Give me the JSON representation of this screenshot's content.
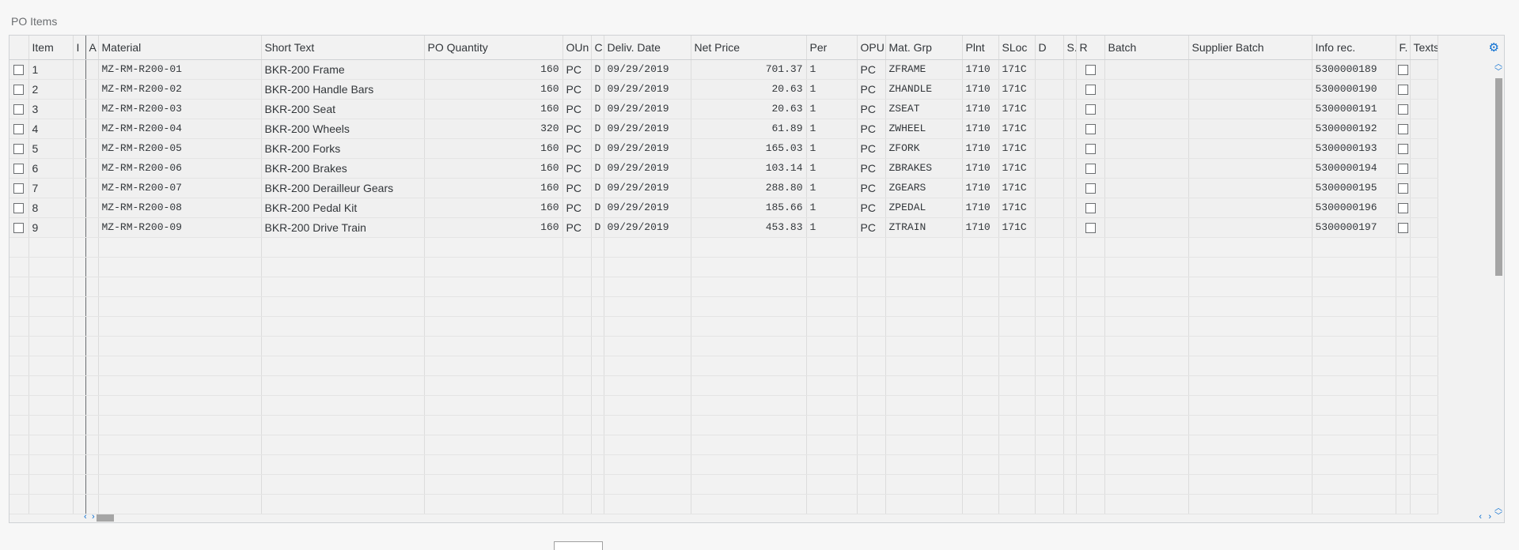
{
  "section_title": "PO Items",
  "columns": [
    "Item",
    "I",
    "A",
    "Material",
    "Short Text",
    "PO Quantity",
    "OUn",
    "C",
    "Deliv. Date",
    "Net Price",
    "Per",
    "OPU",
    "Mat. Grp",
    "Plnt",
    "SLoc",
    "D",
    "S.",
    "R",
    "Batch",
    "Supplier Batch",
    "Info rec.",
    "F.",
    "Texts"
  ],
  "rows": [
    {
      "item": "1",
      "material": "MZ-RM-R200-01",
      "short_text": "BKR-200 Frame",
      "qty": "160",
      "oun": "PC",
      "c": "D",
      "date": "09/29/2019",
      "price": "701.37",
      "per": "1",
      "opu": "PC",
      "matgrp": "ZFRAME",
      "plnt": "1710",
      "sloc": "171C",
      "info": "5300000189"
    },
    {
      "item": "2",
      "material": "MZ-RM-R200-02",
      "short_text": "BKR-200 Handle Bars",
      "qty": "160",
      "oun": "PC",
      "c": "D",
      "date": "09/29/2019",
      "price": "20.63",
      "per": "1",
      "opu": "PC",
      "matgrp": "ZHANDLE",
      "plnt": "1710",
      "sloc": "171C",
      "info": "5300000190"
    },
    {
      "item": "3",
      "material": "MZ-RM-R200-03",
      "short_text": "BKR-200 Seat",
      "qty": "160",
      "oun": "PC",
      "c": "D",
      "date": "09/29/2019",
      "price": "20.63",
      "per": "1",
      "opu": "PC",
      "matgrp": "ZSEAT",
      "plnt": "1710",
      "sloc": "171C",
      "info": "5300000191"
    },
    {
      "item": "4",
      "material": "MZ-RM-R200-04",
      "short_text": "BKR-200 Wheels",
      "qty": "320",
      "oun": "PC",
      "c": "D",
      "date": "09/29/2019",
      "price": "61.89",
      "per": "1",
      "opu": "PC",
      "matgrp": "ZWHEEL",
      "plnt": "1710",
      "sloc": "171C",
      "info": "5300000192"
    },
    {
      "item": "5",
      "material": "MZ-RM-R200-05",
      "short_text": "BKR-200 Forks",
      "qty": "160",
      "oun": "PC",
      "c": "D",
      "date": "09/29/2019",
      "price": "165.03",
      "per": "1",
      "opu": "PC",
      "matgrp": "ZFORK",
      "plnt": "1710",
      "sloc": "171C",
      "info": "5300000193"
    },
    {
      "item": "6",
      "material": "MZ-RM-R200-06",
      "short_text": "BKR-200 Brakes",
      "qty": "160",
      "oun": "PC",
      "c": "D",
      "date": "09/29/2019",
      "price": "103.14",
      "per": "1",
      "opu": "PC",
      "matgrp": "ZBRAKES",
      "plnt": "1710",
      "sloc": "171C",
      "info": "5300000194"
    },
    {
      "item": "7",
      "material": "MZ-RM-R200-07",
      "short_text": "BKR-200 Derailleur Gears",
      "qty": "160",
      "oun": "PC",
      "c": "D",
      "date": "09/29/2019",
      "price": "288.80",
      "per": "1",
      "opu": "PC",
      "matgrp": "ZGEARS",
      "plnt": "1710",
      "sloc": "171C",
      "info": "5300000195"
    },
    {
      "item": "8",
      "material": "MZ-RM-R200-08",
      "short_text": "BKR-200 Pedal Kit",
      "qty": "160",
      "oun": "PC",
      "c": "D",
      "date": "09/29/2019",
      "price": "185.66",
      "per": "1",
      "opu": "PC",
      "matgrp": "ZPEDAL",
      "plnt": "1710",
      "sloc": "171C",
      "info": "5300000196"
    },
    {
      "item": "9",
      "material": "MZ-RM-R200-09",
      "short_text": "BKR-200 Drive Train",
      "qty": "160",
      "oun": "PC",
      "c": "D",
      "date": "09/29/2019",
      "price": "453.83",
      "per": "1",
      "opu": "PC",
      "matgrp": "ZTRAIN",
      "plnt": "1710",
      "sloc": "171C",
      "info": "5300000197"
    }
  ],
  "icons": {
    "settings": "gear-icon"
  }
}
